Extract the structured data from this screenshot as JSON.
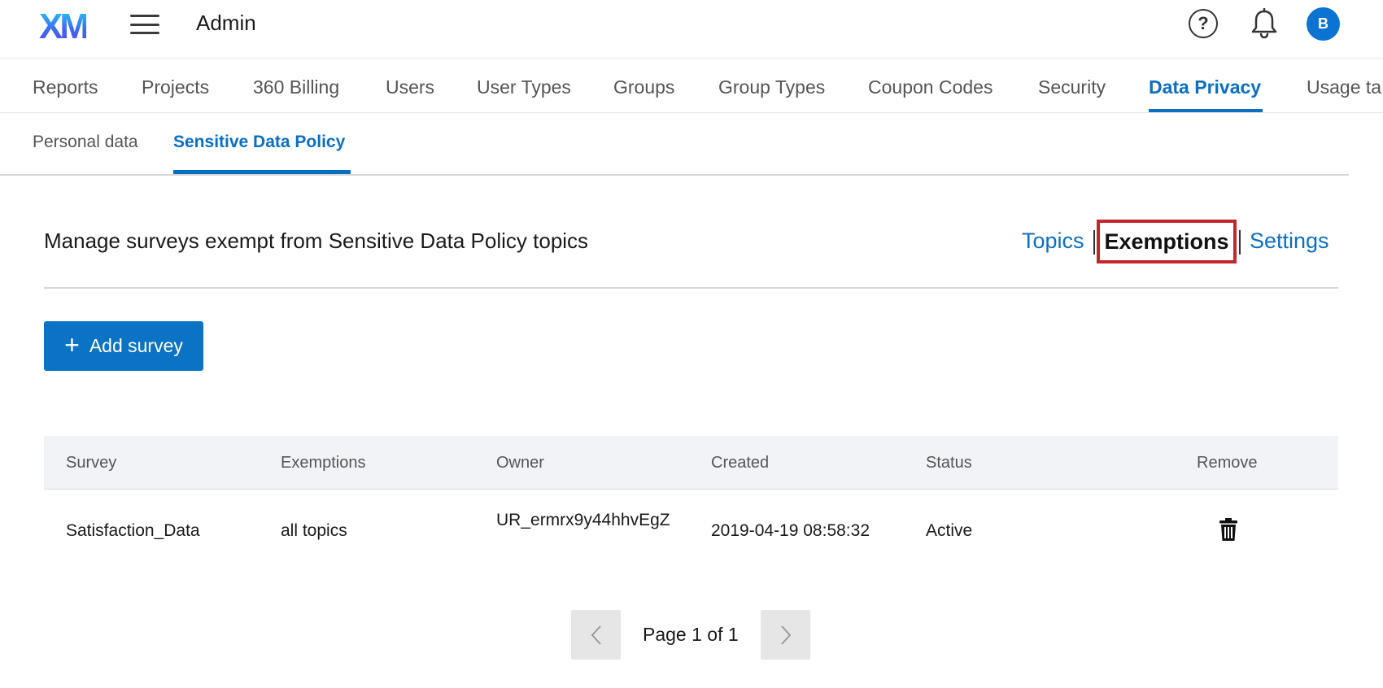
{
  "header": {
    "logo_text": "XM",
    "app_title": "Admin",
    "avatar_initial": "B",
    "icons": [
      "menu-icon",
      "help-icon",
      "bell-icon"
    ]
  },
  "main_nav": {
    "tabs": [
      {
        "label": "Reports"
      },
      {
        "label": "Projects"
      },
      {
        "label": "360 Billing"
      },
      {
        "label": "Users"
      },
      {
        "label": "User Types"
      },
      {
        "label": "Groups"
      },
      {
        "label": "Group Types"
      },
      {
        "label": "Coupon Codes"
      },
      {
        "label": "Security"
      },
      {
        "label": "Data Privacy",
        "active": true
      },
      {
        "label": "Usage ta"
      }
    ]
  },
  "sub_nav": {
    "tabs": [
      {
        "label": "Personal data"
      },
      {
        "label": "Sensitive Data Policy",
        "active": true
      }
    ]
  },
  "section": {
    "title": "Manage surveys exempt from Sensitive Data Policy topics",
    "links": {
      "topics": "Topics",
      "exemptions": "Exemptions",
      "settings": "Settings"
    },
    "highlight_color": "#c1272d"
  },
  "actions": {
    "add_survey": "Add survey"
  },
  "table": {
    "columns": [
      "Survey",
      "Exemptions",
      "Owner",
      "Created",
      "Status",
      "Remove"
    ],
    "rows": [
      {
        "survey": "Satisfaction_Data",
        "exemptions": "all topics",
        "owner": "UR_ermrx9y44hhvEgZ",
        "created": "2019-04-19 08:58:32",
        "status": "Active"
      }
    ]
  },
  "pagination": {
    "label": "Page 1 of 1"
  },
  "colors": {
    "accent": "#0b6fc1",
    "button": "#0b73c4"
  }
}
